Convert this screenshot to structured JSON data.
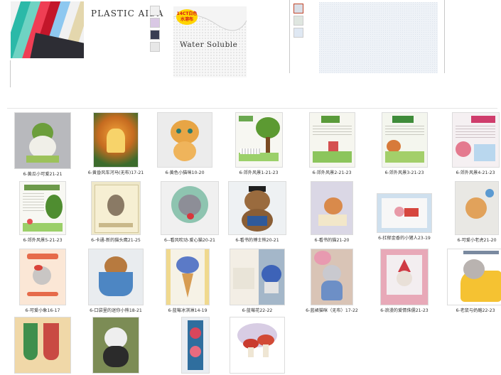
{
  "banner": {
    "plastic_title": "PLASTIC AIDA",
    "water_badge": "14CT白色\n水溶布",
    "water_label": "Water Soluble"
  },
  "products": [
    {
      "caption": "6-黄瓜小可爱21-21"
    },
    {
      "caption": "6-黄昏风车河马(无布)17-21"
    },
    {
      "caption": "6-黄色小猫咪10-20"
    },
    {
      "caption": "6-郊外风景1-21-23"
    },
    {
      "caption": "6-郊外风景2-21-23"
    },
    {
      "caption": "6-郊外风景3-21-23"
    },
    {
      "caption": "6-郊外风景4-21-23"
    },
    {
      "caption": "6-郊外风景5-21-23"
    },
    {
      "caption": "6-卡通-新的猫头鹰21-25"
    },
    {
      "caption": "6--看风吹动-爱心猫20-21"
    },
    {
      "caption": "6-看书的博士熊20-21"
    },
    {
      "caption": "6-看书的猫21-20"
    },
    {
      "caption": "6-扛郁金香的小猪人23-19"
    },
    {
      "caption": "6-可爱小老虎21-20"
    },
    {
      "caption": "6-可爱小象16-17"
    },
    {
      "caption": "6-口袋里的迷你小熊18-21"
    },
    {
      "caption": "6-蓝莓冰淇淋14-19"
    },
    {
      "caption": "6-蓝莓花22-22"
    },
    {
      "caption": "6-蓝裙猫咪（无布）17-22"
    },
    {
      "caption": "6-浪漫的爱情侏儒21-23"
    },
    {
      "caption": "6-老鼠与奶酪22-23"
    },
    {
      "caption": ""
    },
    {
      "caption": ""
    },
    {
      "caption": ""
    },
    {
      "caption": ""
    }
  ],
  "colors": {
    "divider": "#e5e5e5",
    "border": "#dcdcdc",
    "badge": "#ffd400",
    "badge_text": "#d61a1a"
  }
}
